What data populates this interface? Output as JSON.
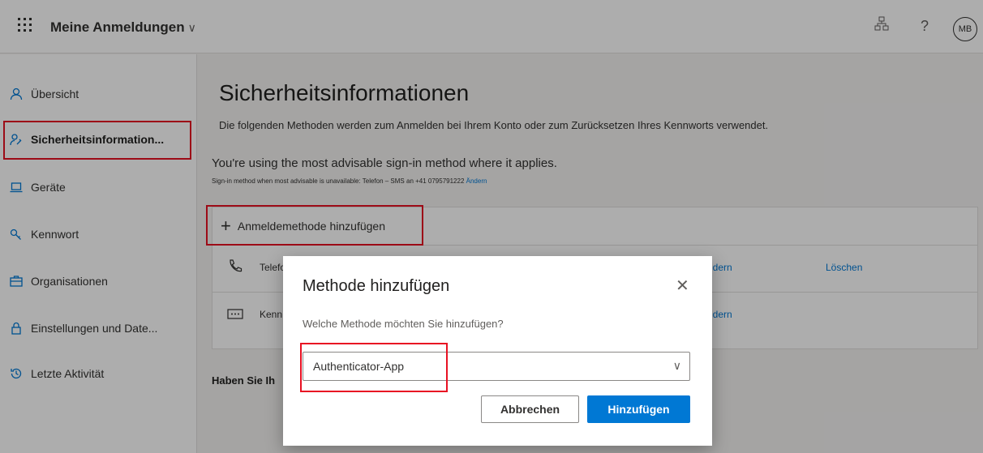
{
  "header": {
    "app_title": "Meine Anmeldungen",
    "avatar_initials": "MB",
    "help_glyph": "?"
  },
  "sidebar": {
    "items": [
      {
        "label": "Übersicht",
        "icon": "person-icon"
      },
      {
        "label": "Sicherheitsinformation...",
        "icon": "security-info-icon",
        "active": true
      },
      {
        "label": "Geräte",
        "icon": "laptop-icon"
      },
      {
        "label": "Kennwort",
        "icon": "key-icon"
      },
      {
        "label": "Organisationen",
        "icon": "briefcase-icon"
      },
      {
        "label": "Einstellungen und Date...",
        "icon": "lock-icon"
      },
      {
        "label": "Letzte Aktivität",
        "icon": "history-icon"
      }
    ]
  },
  "main": {
    "title": "Sicherheitsinformationen",
    "subtitle": "Die folgenden Methoden werden zum Anmelden bei Ihrem Konto oder zum Zurücksetzen Ihres Kennworts verwendet.",
    "advisable": "You're using the most advisable sign-in method where it applies.",
    "fallback_text": "Sign-in method when most advisable is unavailable: Telefon – SMS an +41 0795791222",
    "fallback_link": "Ändern",
    "add_method_label": "Anmeldemethode hinzufügen",
    "methods": [
      {
        "name": "Telefo",
        "change": "ndern",
        "delete": "Löschen"
      },
      {
        "name": "Kenn",
        "change": "ndern",
        "delete": ""
      }
    ],
    "footer_question": "Haben Sie Ih"
  },
  "dialog": {
    "title": "Methode hinzufügen",
    "close_glyph": "✕",
    "question": "Welche Methode möchten Sie hinzufügen?",
    "selected_method": "Authenticator-App",
    "cancel_label": "Abbrechen",
    "add_label": "Hinzufügen"
  },
  "colors": {
    "accent": "#0078d4",
    "highlight": "#e81123"
  }
}
